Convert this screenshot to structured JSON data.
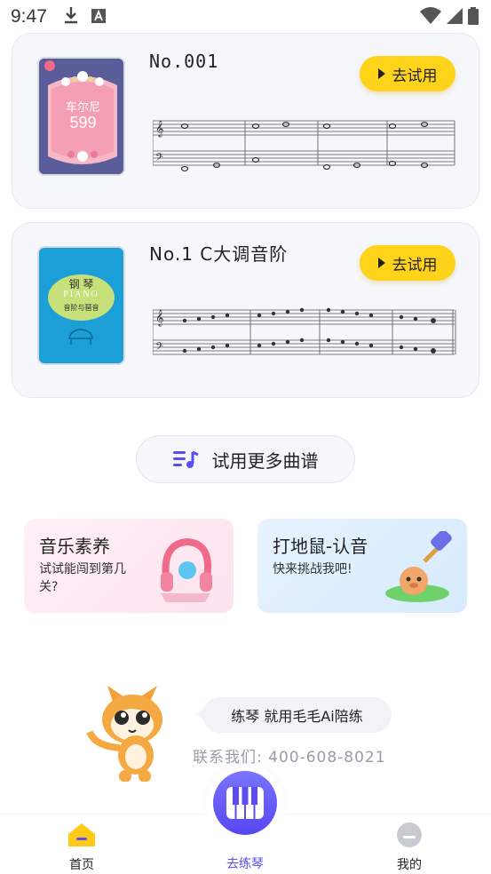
{
  "status_bar": {
    "time": "9:47"
  },
  "songs": [
    {
      "title": "No.001",
      "button_label": "去试用",
      "cover": {
        "title": "车尔尼",
        "number": "599"
      }
    },
    {
      "title": "No.1  C大调音阶",
      "button_label": "去试用",
      "cover": {
        "title": "钢 琴",
        "subtitle": "PIANO",
        "caption": "音阶与琶音"
      }
    }
  ],
  "more_button": {
    "label": "试用更多曲谱"
  },
  "features": [
    {
      "title": "音乐素养",
      "subtitle": "试试能闯到第几关?"
    },
    {
      "title": "打地鼠-认音",
      "subtitle": "快来挑战我吧!"
    }
  ],
  "promo": {
    "slogan": "练琴 就用毛毛Ai陪练",
    "contact": "联系我们: 400-608-8021"
  },
  "bottom_nav": {
    "home": "首页",
    "practice": "去练琴",
    "mine": "我的"
  },
  "colors": {
    "accent_yellow": "#ffd31a",
    "accent_purple": "#5b4df2",
    "card_bg": "#f6f7fb"
  }
}
